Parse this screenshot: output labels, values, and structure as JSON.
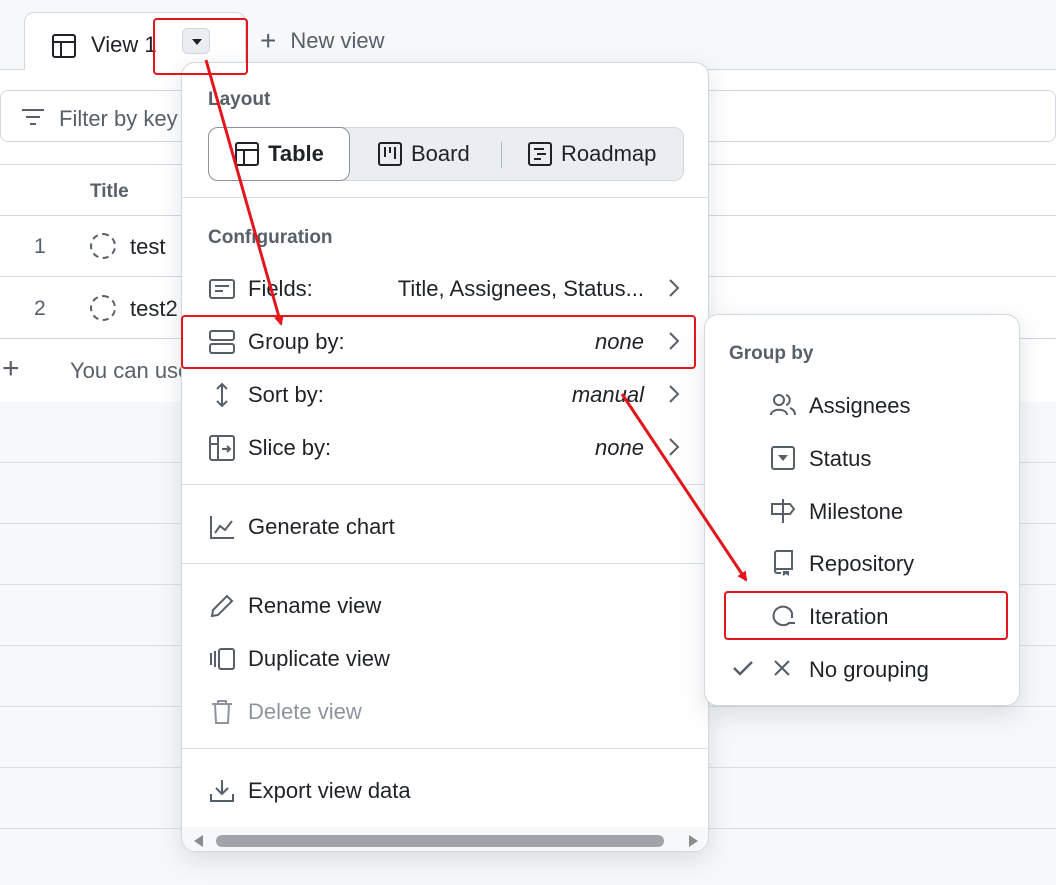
{
  "tabs": {
    "active_label": "View 1",
    "new_view_label": "New view"
  },
  "filter": {
    "placeholder": "Filter by key"
  },
  "table": {
    "title_header": "Title",
    "rows": [
      {
        "number": "1",
        "title": "test"
      },
      {
        "number": "2",
        "title": "test2"
      }
    ],
    "add_hint": "You can use"
  },
  "menu": {
    "layout_title": "Layout",
    "layouts": [
      {
        "label": "Table",
        "icon": "table-icon",
        "active": true
      },
      {
        "label": "Board",
        "icon": "board-icon",
        "active": false
      },
      {
        "label": "Roadmap",
        "icon": "roadmap-icon",
        "active": false
      }
    ],
    "config_title": "Configuration",
    "fields": {
      "label": "Fields:",
      "value": "Title, Assignees, Status..."
    },
    "group_by": {
      "label": "Group by:",
      "value": "none"
    },
    "sort_by": {
      "label": "Sort by:",
      "value": "manual"
    },
    "slice_by": {
      "label": "Slice by:",
      "value": "none"
    },
    "generate_chart": "Generate chart",
    "rename_view": "Rename view",
    "duplicate_view": "Duplicate view",
    "delete_view": "Delete view",
    "export_view": "Export view data"
  },
  "submenu": {
    "title": "Group by",
    "items": [
      {
        "label": "Assignees",
        "icon": "people-icon"
      },
      {
        "label": "Status",
        "icon": "single-select-icon"
      },
      {
        "label": "Milestone",
        "icon": "milestone-icon"
      },
      {
        "label": "Repository",
        "icon": "repo-icon"
      },
      {
        "label": "Iteration",
        "icon": "iteration-icon"
      },
      {
        "label": "No grouping",
        "icon": "x-icon",
        "checked": true
      }
    ]
  },
  "colors": {
    "annotation": "#e3161d",
    "text": "#1f2328",
    "muted": "#57606a",
    "border": "#d0d7de"
  }
}
